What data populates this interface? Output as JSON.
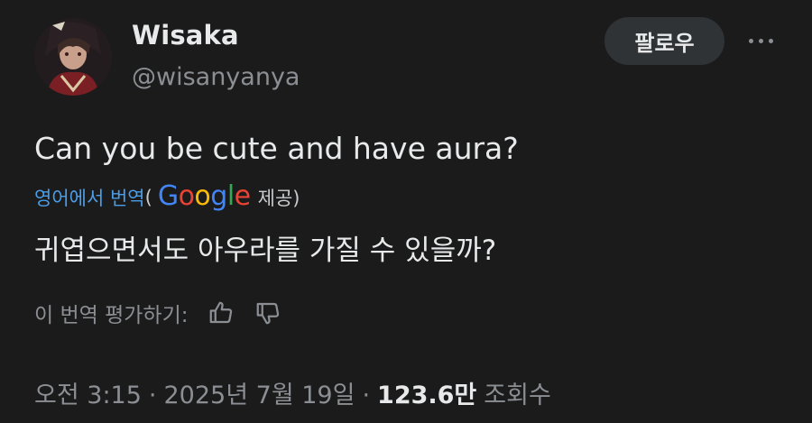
{
  "author": {
    "name": "Wisaka",
    "handle": "@wisanyanya"
  },
  "actions": {
    "follow_label": "팔로우"
  },
  "tweet": {
    "text": "Can you be cute and have aura?",
    "translate_link": "영어에서 번역",
    "paren_open": "(",
    "provider": "Google",
    "provided_suffix": "제공)",
    "translated_text": "귀엽으면서도 아우라를 가질 수 있을까?",
    "rate_label": "이 번역 평가하기:"
  },
  "meta": {
    "time": "오전 3:15",
    "separator": "·",
    "date": "2025년 7월 19일",
    "views_count": "123.6만",
    "views_label": "조회수"
  },
  "icons": {
    "more": "more-horizontal-icon",
    "thumbs_up": "thumbs-up-icon",
    "thumbs_down": "thumbs-down-icon"
  },
  "colors": {
    "background": "#1b1b1b",
    "link": "#4b9de8",
    "text": "#e7e9ea",
    "muted": "#8b8f94",
    "button_bg": "#2f3336",
    "google_blue": "#4285F4",
    "google_red": "#EA4335",
    "google_yellow": "#FBBC05",
    "google_green": "#34A853"
  }
}
